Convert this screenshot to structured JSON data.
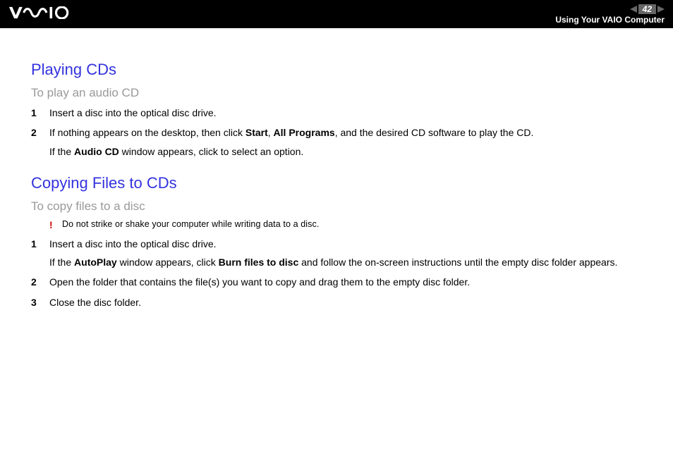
{
  "header": {
    "page_number": "42",
    "breadcrumb": "Using Your VAIO Computer"
  },
  "section1": {
    "heading": "Playing CDs",
    "sub_heading": "To play an audio CD",
    "steps": {
      "s1": {
        "num": "1",
        "text": "Insert a disc into the optical disc drive."
      },
      "s2": {
        "num": "2",
        "pre": "If nothing appears on the desktop, then click ",
        "b1": "Start",
        "mid1": ", ",
        "b2": "All Programs",
        "post1": ", and the desired CD software to play the CD.",
        "extra_pre": "If the ",
        "extra_b": "Audio CD",
        "extra_post": " window appears, click to select an option."
      }
    }
  },
  "section2": {
    "heading": "Copying Files to CDs",
    "sub_heading": "To copy files to a disc",
    "warning": {
      "mark": "!",
      "text": "Do not strike or shake your computer while writing data to a disc."
    },
    "steps": {
      "s1": {
        "num": "1",
        "line1": "Insert a disc into the optical disc drive.",
        "l2_pre": "If the ",
        "l2_b1": "AutoPlay",
        "l2_mid": " window appears, click ",
        "l2_b2": "Burn files to disc",
        "l2_post": " and follow the on-screen instructions until the empty disc folder appears."
      },
      "s2": {
        "num": "2",
        "text": "Open the folder that contains the file(s) you want to copy and drag them to the empty disc folder."
      },
      "s3": {
        "num": "3",
        "text": "Close the disc folder."
      }
    }
  }
}
